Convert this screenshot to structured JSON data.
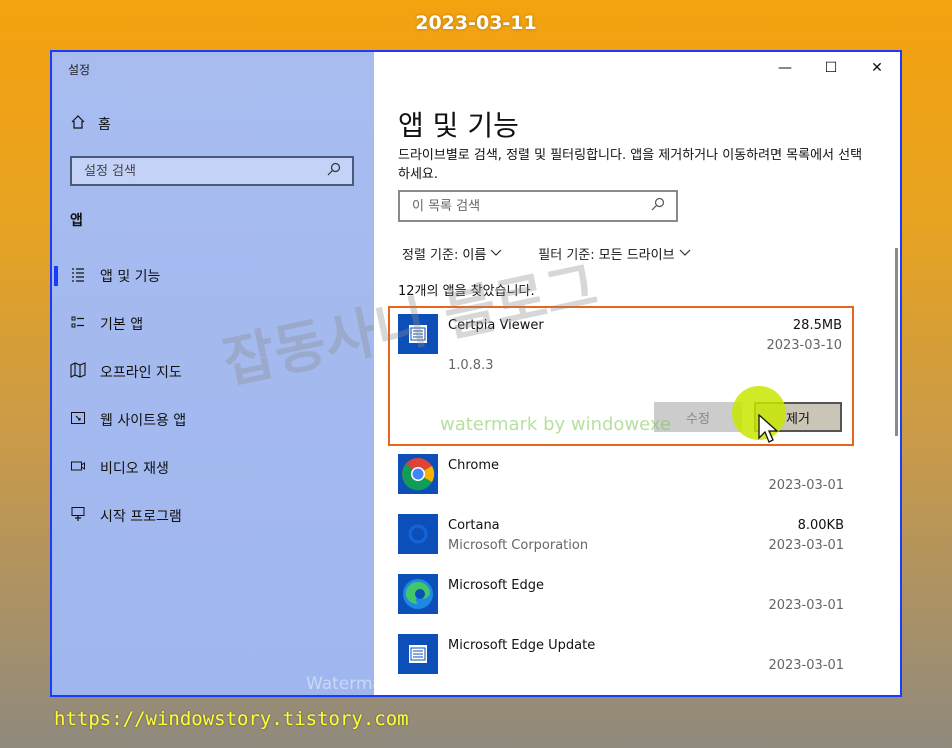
{
  "banner": {
    "date": "2023-03-11"
  },
  "footer": {
    "url": "https://windowstory.tistory.com"
  },
  "window": {
    "app_title": "설정",
    "controls": {
      "minimize": "—",
      "maximize": "☐",
      "close": "✕"
    }
  },
  "sidebar": {
    "home_label": "홈",
    "search_placeholder": "설정 검색",
    "section_title": "앱",
    "items": [
      {
        "label": "앱 및 기능",
        "icon": "apps-features-icon",
        "active": true
      },
      {
        "label": "기본 앱",
        "icon": "default-apps-icon",
        "active": false
      },
      {
        "label": "오프라인 지도",
        "icon": "offline-maps-icon",
        "active": false
      },
      {
        "label": "웹 사이트용 앱",
        "icon": "apps-for-websites-icon",
        "active": false
      },
      {
        "label": "비디오 재생",
        "icon": "video-playback-icon",
        "active": false
      },
      {
        "label": "시작 프로그램",
        "icon": "startup-icon",
        "active": false
      }
    ]
  },
  "main": {
    "title": "앱 및 기능",
    "description": "드라이브별로 검색, 정렬 및 필터링합니다. 앱을 제거하거나 이동하려면 목록에서 선택하세요.",
    "search_placeholder": "이 목록 검색",
    "sort_label": "정렬 기준:",
    "sort_value": "이름",
    "filter_label": "필터 기준:",
    "filter_value": "모든 드라이브",
    "count_text": "12개의 앱을 찾았습니다.",
    "apps": [
      {
        "name": "Certpia Viewer",
        "publisher": "",
        "size": "28.5MB",
        "date": "2023-03-10",
        "version": "1.0.8.3",
        "icon": "window-app-icon"
      },
      {
        "name": "Chrome",
        "publisher": "",
        "size": "",
        "date": "2023-03-01",
        "icon": "chrome-icon"
      },
      {
        "name": "Cortana",
        "publisher": "Microsoft Corporation",
        "size": "8.00KB",
        "date": "2023-03-01",
        "icon": "cortana-icon"
      },
      {
        "name": "Microsoft Edge",
        "publisher": "",
        "size": "",
        "date": "2023-03-01",
        "icon": "edge-icon"
      },
      {
        "name": "Microsoft Edge Update",
        "publisher": "",
        "size": "",
        "date": "2023-03-01",
        "icon": "window-app-icon"
      }
    ],
    "buttons": {
      "modify": "수정",
      "remove": "제거"
    }
  },
  "watermarks": {
    "big": "잡동사니 블로그",
    "green": "watermark by windowexe",
    "bottom": "Watermarked by WindowexeWatermark"
  },
  "colors": {
    "accent": "#1a3cff",
    "selection_border": "#e8651e",
    "cursor_highlight": "#c8e600"
  }
}
